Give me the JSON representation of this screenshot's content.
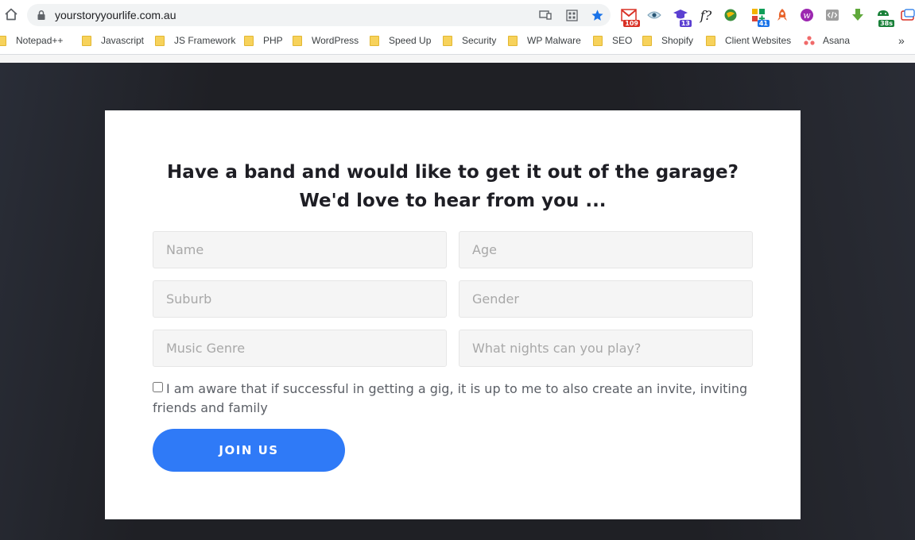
{
  "browser": {
    "url": "yourstoryyourlife.com.au",
    "extensions": [
      {
        "name": "gmail-extension",
        "badge": "109",
        "badge_color": "#d93025"
      },
      {
        "name": "eye-extension",
        "badge": ""
      },
      {
        "name": "grad-cap-extension",
        "badge": "13",
        "badge_color": "#5b3fd1"
      },
      {
        "name": "font-extension",
        "badge": ""
      },
      {
        "name": "globe-extension",
        "badge": ""
      },
      {
        "name": "plus-extension",
        "badge": "41",
        "badge_color": "#1a73e8"
      },
      {
        "name": "rocket-extension",
        "badge": ""
      },
      {
        "name": "w-extension",
        "badge": ""
      },
      {
        "name": "code-extension",
        "badge": ""
      },
      {
        "name": "download-extension",
        "badge": ""
      },
      {
        "name": "android-extension",
        "badge": "38s",
        "badge_color": "#188038"
      },
      {
        "name": "window-extension",
        "badge": ""
      }
    ],
    "bookmarks": [
      "Notepad++",
      "Javascript",
      "JS Framework",
      "PHP",
      "WordPress",
      "Speed Up",
      "Security",
      "WP Malware",
      "SEO",
      "Shopify",
      "Client Websites",
      "Asana"
    ],
    "overflow_label": "»"
  },
  "form": {
    "heading_line1": "Have a band and would like to get it out of the garage?",
    "heading_line2": "We'd love to hear from you ...",
    "fields": {
      "name": "Name",
      "age": "Age",
      "suburb": "Suburb",
      "gender": "Gender",
      "genre": "Music Genre",
      "nights": "What nights can you play?"
    },
    "consent_label": "I am aware that if successful in getting a gig, it is up to me to also create an invite, inviting friends and family",
    "submit_label": "JOIN US"
  },
  "colors": {
    "accent": "#2f7af7",
    "page_bg": "#1f2025",
    "field_bg": "#f5f5f5"
  }
}
